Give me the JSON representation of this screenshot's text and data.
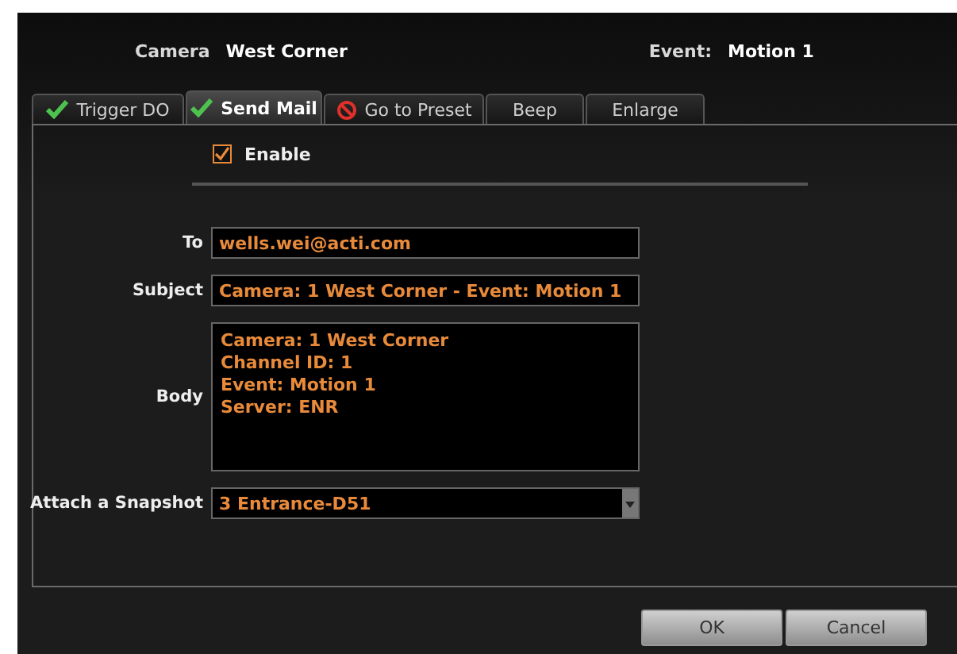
{
  "header": {
    "camera_label": "Camera",
    "camera_value": "West Corner",
    "event_label": "Event:",
    "event_value": "Motion 1"
  },
  "tabs": [
    {
      "label": "Trigger DO",
      "kind": "checked",
      "selected": false
    },
    {
      "label": "Send Mail",
      "kind": "checked",
      "selected": true
    },
    {
      "label": "Go to Preset",
      "kind": "blocked",
      "selected": false
    },
    {
      "label": "Beep",
      "kind": "plain",
      "selected": false
    },
    {
      "label": "Enlarge",
      "kind": "plain",
      "selected": false
    }
  ],
  "enable": {
    "label": "Enable",
    "checked": true
  },
  "form": {
    "to_label": "To",
    "to_value": "wells.wei@acti.com",
    "subject_label": "Subject",
    "subject_value": "Camera: 1 West Corner - Event: Motion 1",
    "body_label": "Body",
    "body_lines": [
      "Camera: 1 West Corner",
      "Channel ID: 1",
      "Event: Motion 1",
      "Server: ENR"
    ],
    "snapshot_label": "Attach a Snapshot",
    "snapshot_value": "3 Entrance-D51"
  },
  "buttons": [
    "OK",
    "Cancel"
  ]
}
